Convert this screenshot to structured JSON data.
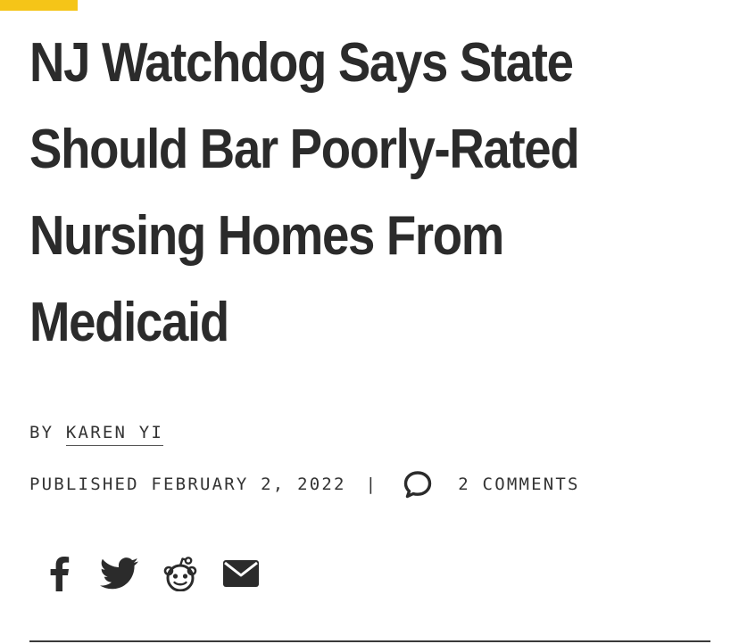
{
  "article": {
    "headline_lines": [
      "NJ Watchdog Says State",
      "Should Bar Poorly-Rated",
      "Nursing Homes From",
      "Medicaid"
    ],
    "byline_prefix": "BY",
    "author": "KAREN YI",
    "published_label": "PUBLISHED",
    "published_date": "FEBRUARY 2, 2022",
    "separator": "|",
    "comments_text": "2 COMMENTS"
  },
  "share": {
    "icons": [
      "facebook-icon",
      "twitter-icon",
      "reddit-icon",
      "email-icon"
    ]
  },
  "colors": {
    "accent": "#f5c518",
    "text": "#2b2b2b",
    "background": "#ffffff"
  }
}
